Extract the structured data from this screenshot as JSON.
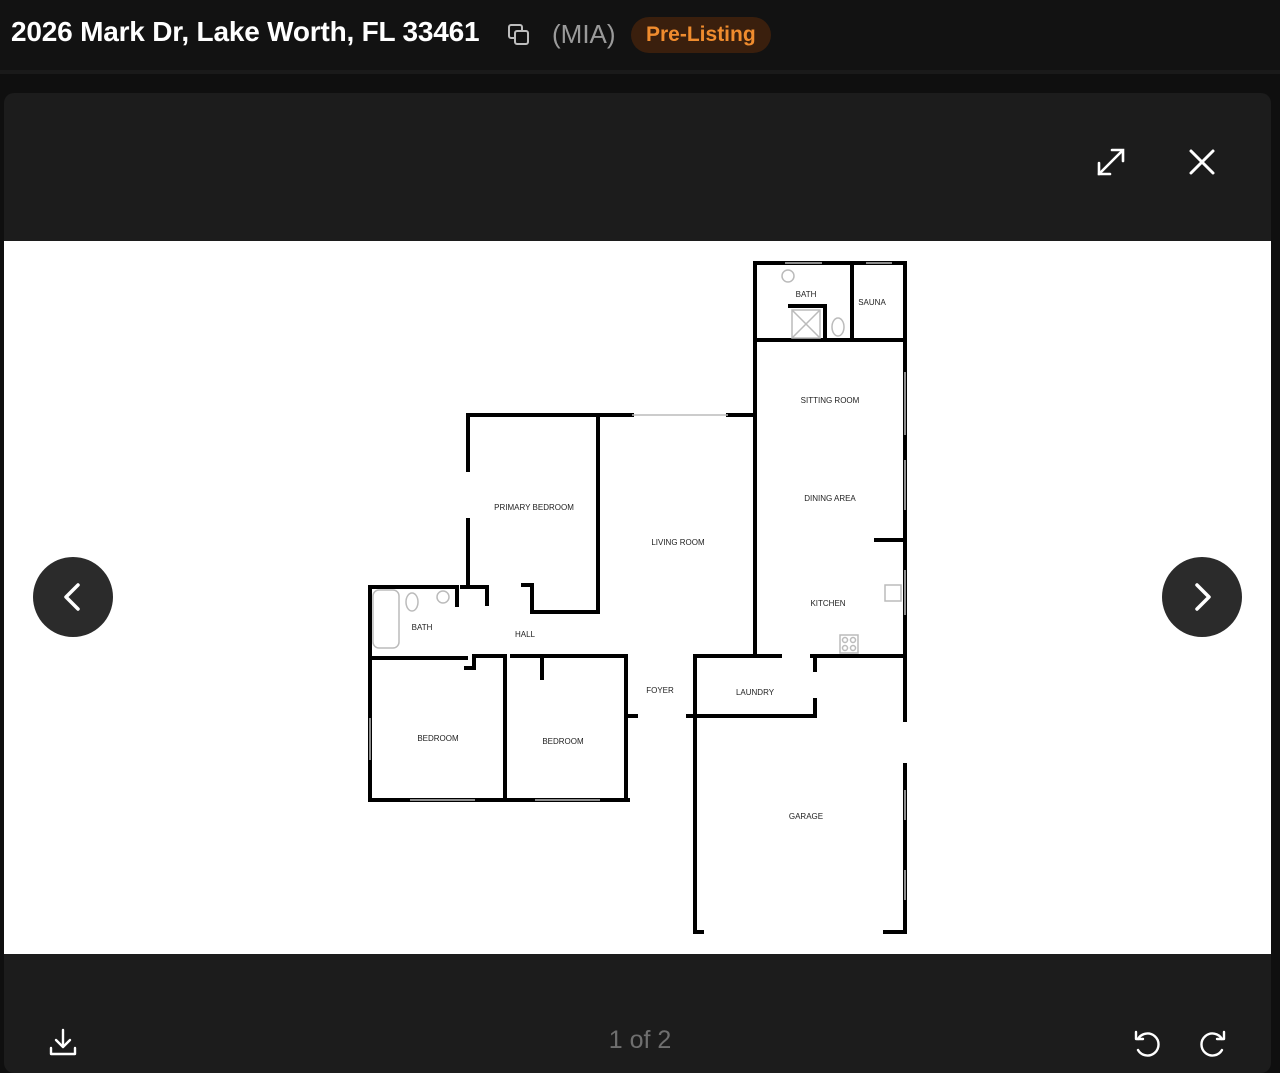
{
  "header": {
    "address": "2026 Mark Dr, Lake Worth, FL 33461",
    "market": "(MIA)",
    "status_badge": "Pre-Listing",
    "status_color": "#f08c2e"
  },
  "viewer": {
    "counter": "1 of 2",
    "icons": {
      "copy": "copy-icon",
      "expand": "expand-icon",
      "close": "close-icon",
      "prev": "chevron-left-icon",
      "next": "chevron-right-icon",
      "download": "download-icon",
      "rotate_left": "rotate-left-icon",
      "rotate_right": "rotate-right-icon"
    }
  },
  "floorplan": {
    "rooms": [
      {
        "id": "bath-upper",
        "label": "BATH"
      },
      {
        "id": "sauna",
        "label": "SAUNA"
      },
      {
        "id": "sitting-room",
        "label": "SITTING ROOM"
      },
      {
        "id": "dining-area",
        "label": "DINING AREA"
      },
      {
        "id": "primary-bedroom",
        "label": "PRIMARY BEDROOM"
      },
      {
        "id": "living-room",
        "label": "LIVING ROOM"
      },
      {
        "id": "kitchen",
        "label": "KITCHEN"
      },
      {
        "id": "bath-lower",
        "label": "BATH"
      },
      {
        "id": "hall",
        "label": "HALL"
      },
      {
        "id": "foyer",
        "label": "FOYER"
      },
      {
        "id": "laundry",
        "label": "LAUNDRY"
      },
      {
        "id": "bedroom-1",
        "label": "BEDROOM"
      },
      {
        "id": "bedroom-2",
        "label": "BEDROOM"
      },
      {
        "id": "garage",
        "label": "GARAGE"
      }
    ]
  }
}
